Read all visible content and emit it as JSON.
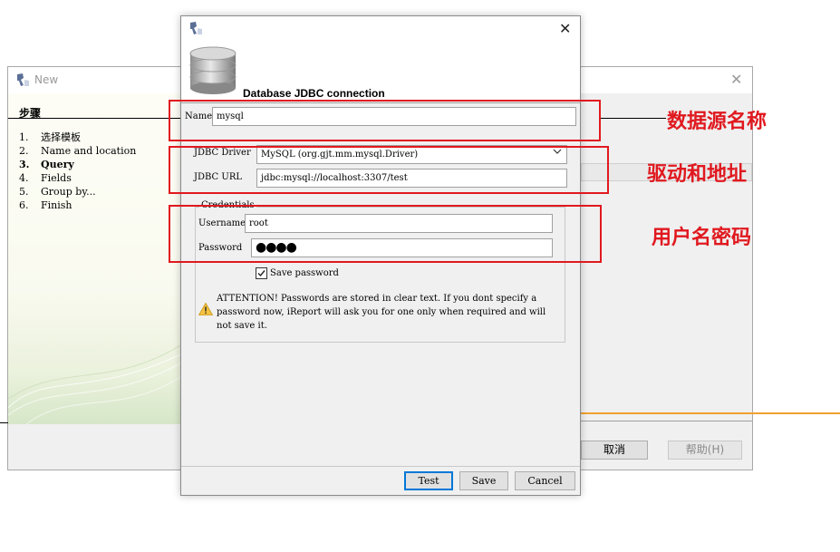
{
  "background_window": {
    "title": "New",
    "steps_title": "步骤",
    "steps": [
      {
        "num": "1.",
        "label": "选择模板"
      },
      {
        "num": "2.",
        "label": "Name and location"
      },
      {
        "num": "3.",
        "label": "Query"
      },
      {
        "num": "4.",
        "label": "Fields"
      },
      {
        "num": "5.",
        "label": "Group by..."
      },
      {
        "num": "6.",
        "label": "Finish"
      }
    ],
    "active_step_index": 2,
    "cancel_label": "取消",
    "help_label": "帮助(H)"
  },
  "dialog": {
    "title": "Database JDBC connection",
    "name_label": "Name",
    "name_value": "mysql",
    "driver_label": "JDBC Driver",
    "driver_value": "MySQL (org.gjt.mm.mysql.Driver)",
    "url_label": "JDBC URL",
    "url_value": "jdbc:mysql://localhost:3307/test",
    "credentials_legend": "Credentials",
    "username_label": "Username",
    "username_value": "root",
    "password_label": "Password",
    "password_masked": "●●●●",
    "save_password_label": "Save password",
    "save_password_checked": true,
    "warning_text": "ATTENTION! Passwords are stored in clear text. If you dont specify a password now, iReport will ask you for one only when required and will not save it.",
    "buttons": {
      "test": "Test",
      "save": "Save",
      "cancel": "Cancel"
    }
  },
  "annotations": {
    "name": "数据源名称",
    "driver_url": "驱动和地址",
    "credentials": "用户名密码",
    "color": "#e0191f"
  },
  "icons": {
    "app": "ireport-app-icon",
    "close": "close-icon",
    "database": "database-icon",
    "warning": "warning-icon",
    "dropdown": "chevron-down-icon",
    "checkbox": "checkmark-icon"
  }
}
